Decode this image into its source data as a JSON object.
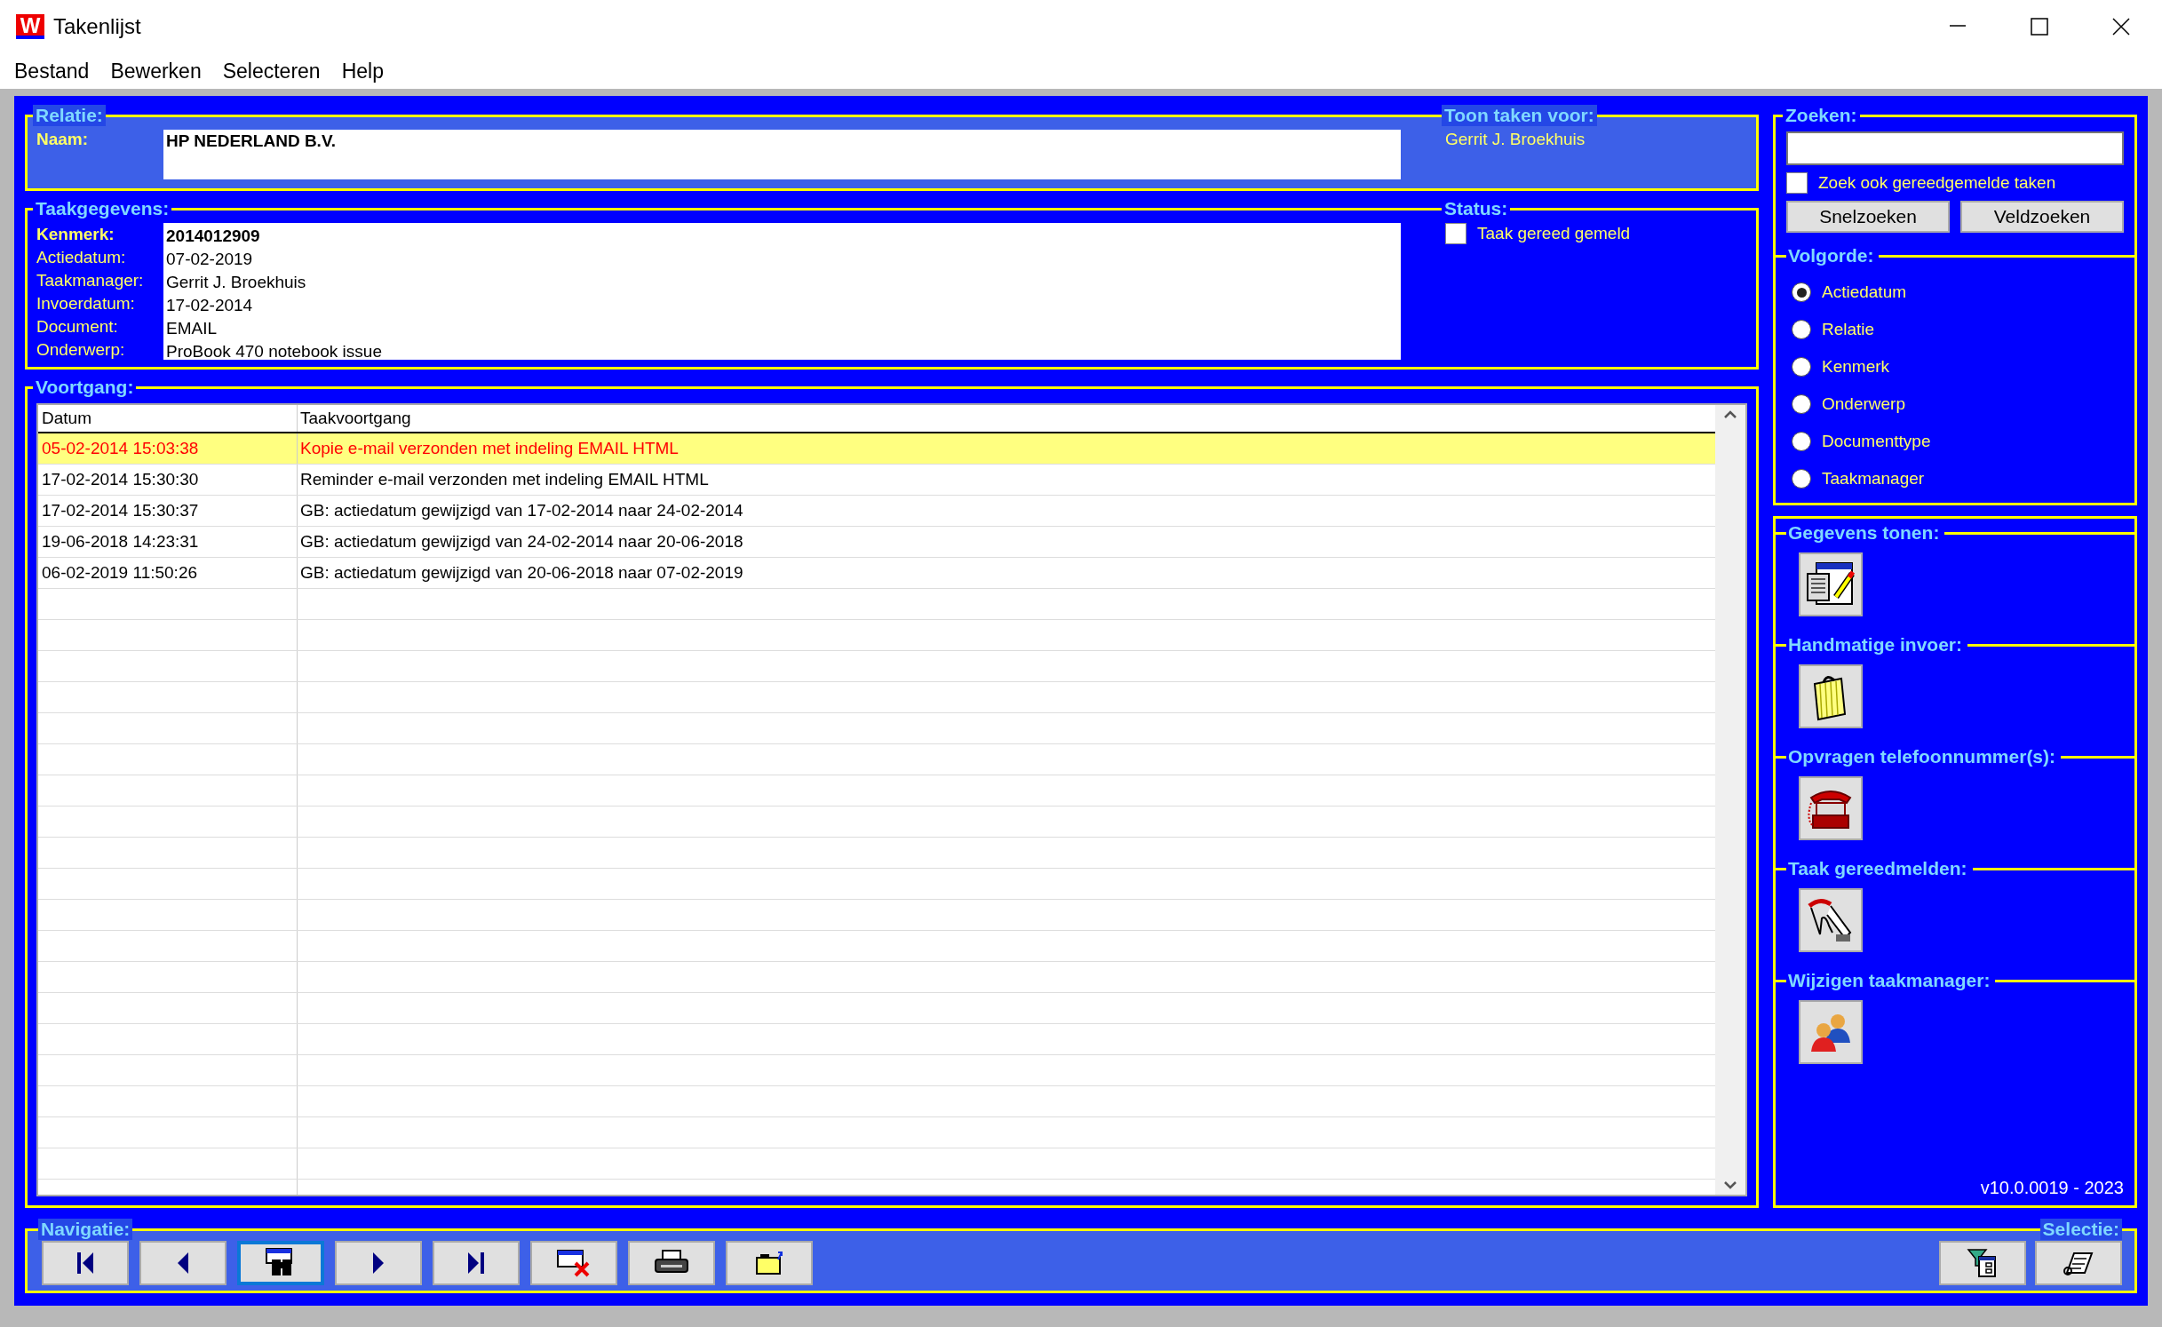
{
  "window": {
    "logo": "W",
    "title": "Takenlijst"
  },
  "menu": [
    {
      "label": "Bestand"
    },
    {
      "label": "Bewerken"
    },
    {
      "label": "Selecteren"
    },
    {
      "label": "Help"
    }
  ],
  "relatie": {
    "legend": "Relatie:",
    "label": "Naam:",
    "value": "HP NEDERLAND B.V."
  },
  "toon_taken_voor": {
    "legend": "Toon taken voor:",
    "value": "Gerrit J. Broekhuis"
  },
  "taakgegevens": {
    "legend": "Taakgegevens:",
    "fields": [
      {
        "label": "Kenmerk:",
        "value": "2014012909",
        "bold": true
      },
      {
        "label": "Actiedatum:",
        "value": "07-02-2019",
        "bold": false
      },
      {
        "label": "Taakmanager:",
        "value": "Gerrit J. Broekhuis",
        "bold": false
      },
      {
        "label": "Invoerdatum:",
        "value": "17-02-2014",
        "bold": false
      },
      {
        "label": "Document:",
        "value": "EMAIL",
        "bold": false
      },
      {
        "label": "Onderwerp:",
        "value": "ProBook 470 notebook issue",
        "bold": false
      }
    ]
  },
  "status": {
    "legend": "Status:",
    "label": "Taak gereed gemeld",
    "checked": false
  },
  "voortgang": {
    "legend": "Voortgang:",
    "columns": [
      "Datum",
      "Taakvoortgang"
    ],
    "rows": [
      {
        "datum": "05-02-2014 15:03:38",
        "taak": "Kopie e-mail verzonden met indeling EMAIL HTML",
        "selected": true
      },
      {
        "datum": "17-02-2014 15:30:30",
        "taak": "Reminder e-mail verzonden met indeling EMAIL HTML",
        "selected": false
      },
      {
        "datum": "17-02-2014 15:30:37",
        "taak": "GB: actiedatum gewijzigd van 17-02-2014 naar 24-02-2014",
        "selected": false
      },
      {
        "datum": "19-06-2018 14:23:31",
        "taak": "GB: actiedatum gewijzigd van 24-02-2014 naar 20-06-2018",
        "selected": false
      },
      {
        "datum": "06-02-2019 11:50:26",
        "taak": "GB: actiedatum gewijzigd van 20-06-2018 naar 07-02-2019",
        "selected": false
      }
    ]
  },
  "zoeken": {
    "legend": "Zoeken:",
    "option": {
      "label": "Zoek ook gereedgemelde taken",
      "checked": false
    },
    "buttons": [
      {
        "label": "Snelzoeken"
      },
      {
        "label": "Veldzoeken"
      }
    ]
  },
  "volgorde": {
    "legend": "Volgorde:",
    "options": [
      {
        "label": "Actiedatum",
        "selected": true
      },
      {
        "label": "Relatie",
        "selected": false
      },
      {
        "label": "Kenmerk",
        "selected": false
      },
      {
        "label": "Onderwerp",
        "selected": false
      },
      {
        "label": "Documenttype",
        "selected": false
      },
      {
        "label": "Taakmanager",
        "selected": false
      }
    ]
  },
  "actions": [
    {
      "heading": "Gegevens tonen:",
      "kind": "details"
    },
    {
      "heading": "Handmatige invoer:",
      "kind": "manual"
    },
    {
      "heading": "Opvragen telefoonnummer(s):",
      "kind": "phone"
    },
    {
      "heading": "Taak gereedmelden:",
      "kind": "done"
    },
    {
      "heading": "Wijzigen taakmanager:",
      "kind": "manager"
    }
  ],
  "version": "v10.0.0019 - 2023",
  "navigatie": {
    "legend": "Navigatie:",
    "buttons": [
      {
        "kind": "first",
        "focused": false
      },
      {
        "kind": "prev",
        "focused": false
      },
      {
        "kind": "find",
        "focused": true
      },
      {
        "kind": "next",
        "focused": false
      },
      {
        "kind": "last",
        "focused": false
      },
      {
        "kind": "delete",
        "focused": false
      },
      {
        "kind": "print",
        "focused": false
      },
      {
        "kind": "export",
        "focused": false
      }
    ]
  },
  "selectie": {
    "legend": "Selectie:",
    "buttons": [
      {
        "kind": "filter"
      },
      {
        "kind": "list"
      }
    ]
  }
}
